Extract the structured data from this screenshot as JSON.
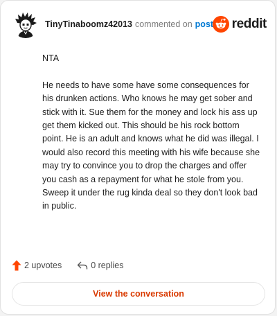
{
  "comment": {
    "username": "TinyTinaboomz42013",
    "action": "commented on",
    "post_link": "post",
    "body": {
      "line1": "NTA",
      "paragraph": "He needs to have some have some consequences for his drunken actions. Who knows he may get sober and stick with it. Sue them for the money and lock his ass up get them kicked out. This should be his rock bottom point. He is an adult and knows what he did was illegal. I would also record this meeting with his wife because she may try to convince you to drop the charges and offer you cash as a repayment for what he stole from you. Sweep it under the rug kinda deal so they don't look bad in public."
    }
  },
  "brand": {
    "name": "reddit",
    "icon": "reddit-alien-icon",
    "color": "#ff4500"
  },
  "footer": {
    "upvotes": "2 upvotes",
    "upvote_icon": "upvote-arrow-icon",
    "replies": "0 replies",
    "reply_icon": "reply-arrow-icon"
  },
  "cta": {
    "label": "View the conversation"
  },
  "colors": {
    "accent": "#d93a00",
    "link": "#0079d3",
    "upvote": "#ff4500"
  }
}
